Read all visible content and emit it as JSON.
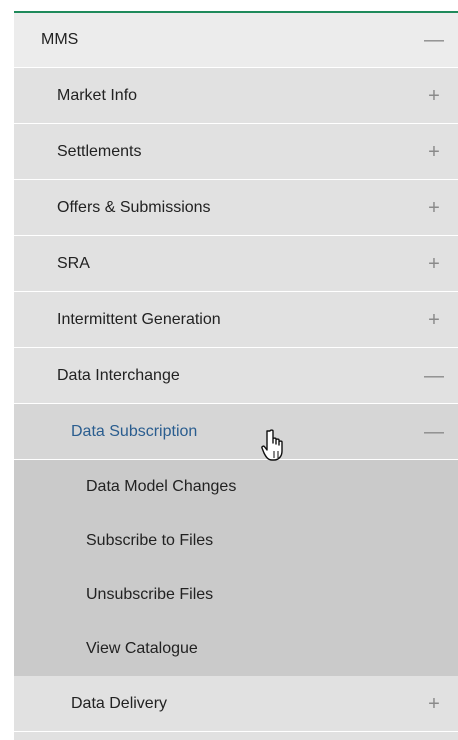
{
  "menu": {
    "root": {
      "label": "MMS",
      "toggle": "—"
    },
    "items": [
      {
        "label": "Market Info",
        "toggle": "+"
      },
      {
        "label": "Settlements",
        "toggle": "+"
      },
      {
        "label": "Offers & Submissions",
        "toggle": "+"
      },
      {
        "label": "SRA",
        "toggle": "+"
      },
      {
        "label": "Intermittent Generation",
        "toggle": "+"
      },
      {
        "label": "Data Interchange",
        "toggle": "—"
      }
    ],
    "sub": {
      "label": "Data Subscription",
      "toggle": "—",
      "children": [
        {
          "label": "Data Model Changes"
        },
        {
          "label": "Subscribe to Files"
        },
        {
          "label": "Unsubscribe Files"
        },
        {
          "label": "View Catalogue"
        }
      ]
    },
    "delivery": {
      "label": "Data Delivery",
      "toggle": "+"
    }
  },
  "colors": {
    "accent_rule": "#1f8a5b",
    "active_link": "#2a5d8f"
  },
  "icons": {
    "cursor": "hand-pointer-icon"
  }
}
